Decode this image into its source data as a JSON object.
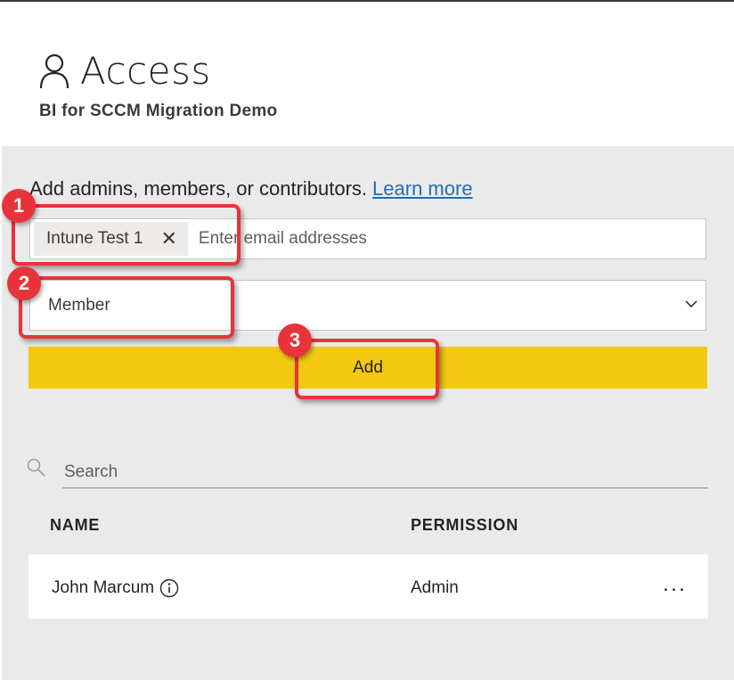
{
  "header": {
    "title": "Access",
    "subtitle": "BI for SCCM Migration Demo",
    "icon": "person-icon"
  },
  "add_section": {
    "instruction": "Add admins, members, or contributors.",
    "learn_more": "Learn more",
    "chip_label": "Intune Test 1",
    "email_placeholder": "Enter email addresses",
    "role_value": "Member",
    "add_button": "Add"
  },
  "search": {
    "placeholder": "Search"
  },
  "table": {
    "columns": [
      "NAME",
      "PERMISSION"
    ],
    "rows": [
      {
        "name": "John Marcum",
        "permission": "Admin",
        "more": "..."
      }
    ]
  },
  "callouts": [
    "1",
    "2",
    "3"
  ],
  "colors": {
    "accent_yellow": "#f2c811",
    "callout_red": "#e8333a",
    "link_blue": "#1f6fb5",
    "panel_gray": "#eaeaea"
  }
}
